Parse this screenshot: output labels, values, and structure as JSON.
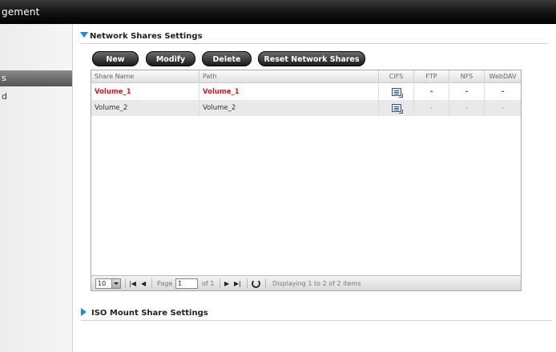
{
  "titlebar": {
    "title": "gement"
  },
  "sidebar": {
    "items": [
      {
        "label": "s"
      },
      {
        "label": "d"
      }
    ]
  },
  "network_shares": {
    "section_title": "Network Shares Settings",
    "buttons": {
      "new": "New",
      "modify": "Modify",
      "delete": "Delete",
      "reset": "Reset Network Shares"
    },
    "columns": [
      "Share Name",
      "Path",
      "CIFS",
      "FTP",
      "NFS",
      "WebDAV"
    ],
    "rows": [
      {
        "name": "Volume_1",
        "path": "Volume_1",
        "cifs_icon": "document-list-icon",
        "ftp": "-",
        "nfs": "-",
        "webdav": "-",
        "highlight": true
      },
      {
        "name": "Volume_2",
        "path": "Volume_2",
        "cifs_icon": "document-list-icon",
        "ftp": "-",
        "nfs": "-",
        "webdav": "-",
        "highlight": false
      }
    ],
    "pager": {
      "page_size": "10",
      "page_label": "Page",
      "page_value": "1",
      "of_label": "of 1",
      "display_text": "Displaying 1 to 2 of 2 items"
    }
  },
  "iso_mount": {
    "section_title": "ISO Mount Share Settings"
  },
  "colors": {
    "accent_blue": "#1a8ae0",
    "highlight_red": "#e0141e",
    "titlebar_black": "#111111"
  }
}
